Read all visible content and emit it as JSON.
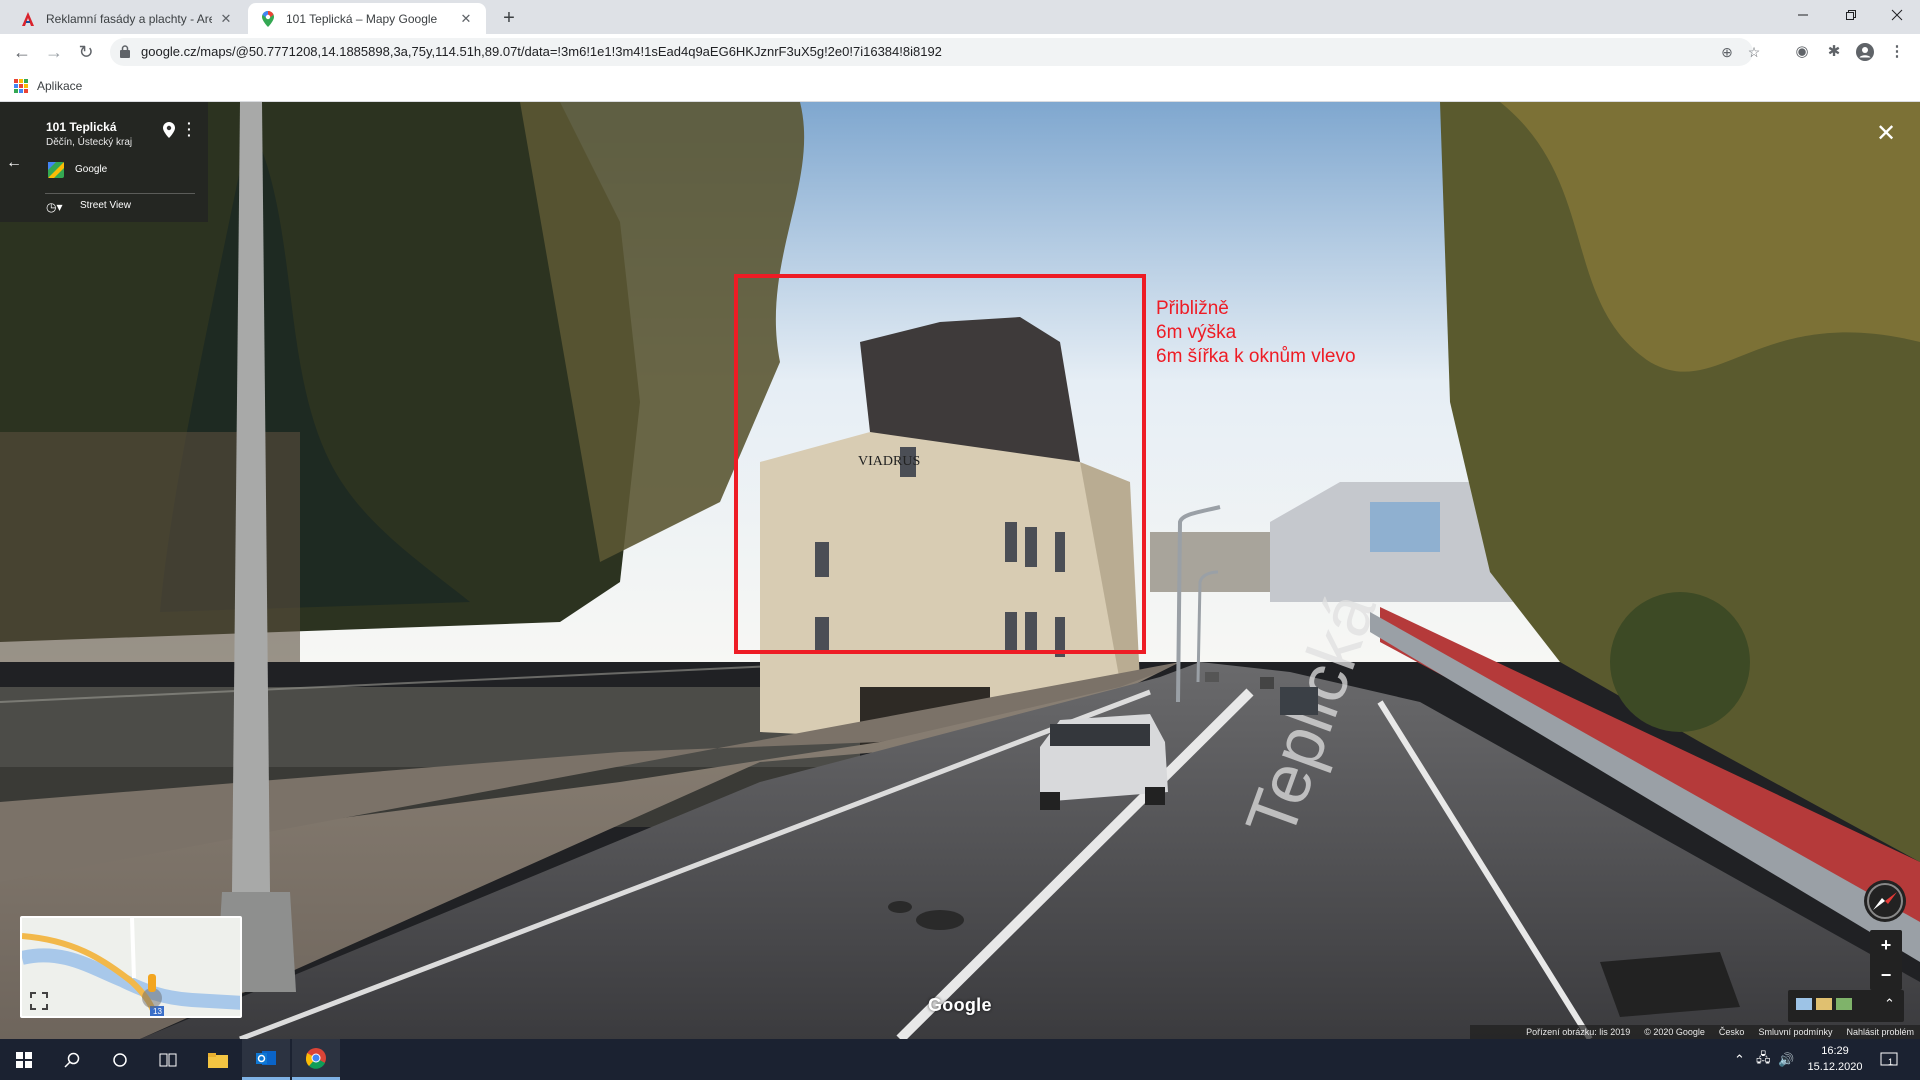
{
  "browser": {
    "tabs": [
      {
        "title": "Reklamní fasády a plachty - Areko",
        "icon": "areko-icon",
        "active": false
      },
      {
        "title": "101 Teplická – Mapy Google",
        "icon": "google-maps-icon",
        "active": true
      }
    ],
    "url": "google.cz/maps/@50.7771208,14.1885898,3a,75y,114.51h,89.07t/data=!3m6!1e1!3m4!1sEad4q9aEG6HKJznrF3uX5g!2e0!7i16384!8i8192",
    "bookmarks": {
      "apps_label": "Aplikace"
    }
  },
  "streetview": {
    "place_title": "101 Teplická",
    "place_subtitle": "Děčín, Ústecký kraj",
    "provider": "Google",
    "mode_label": "Street View",
    "annotation_lines": "Přibližně\n6m výška\n6m šířka k oknům vlevo",
    "annotation_color": "#ee1c25",
    "watermark": "Google",
    "minimap": {
      "road_label": "13"
    },
    "footer": {
      "capture_date": "Pořízení obrázku: lis 2019",
      "copyright": "© 2020 Google",
      "country": "Česko",
      "terms": "Smluvní podmínky",
      "report": "Nahlásit problém"
    },
    "scene_text": {
      "facade_brand": "VIADRUS",
      "road_marking": "Teplická"
    }
  },
  "taskbar": {
    "time": "16:29",
    "date": "15.12.2020",
    "notification_count": "1"
  }
}
